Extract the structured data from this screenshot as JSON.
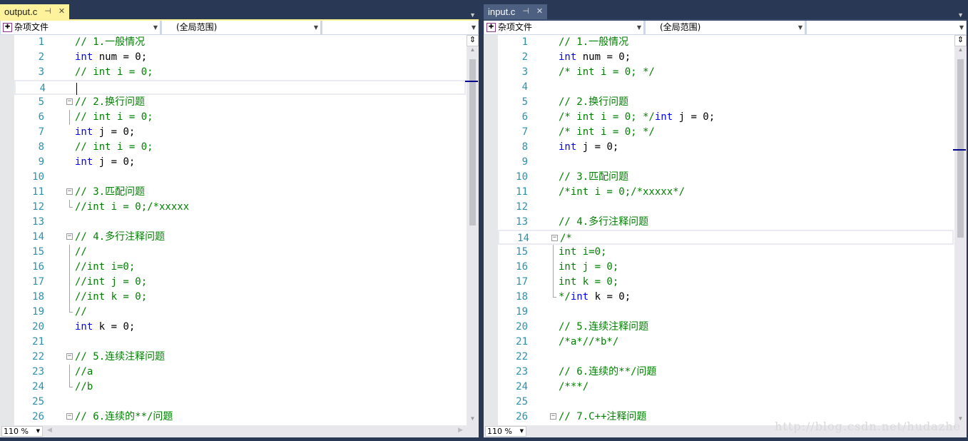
{
  "left": {
    "tab": {
      "title": "output.c",
      "pin": "⊣",
      "close": "✕",
      "active": true
    },
    "nav": {
      "project": "杂项文件",
      "scope": "(全局范围)",
      "member": ""
    },
    "zoom": "110 %",
    "current_line": 4,
    "lines": [
      {
        "n": 1,
        "s": [
          [
            "c",
            "// 1.一般情况"
          ]
        ]
      },
      {
        "n": 2,
        "s": [
          [
            "k",
            "int"
          ],
          [
            "t",
            " num = 0;"
          ]
        ]
      },
      {
        "n": 3,
        "s": [
          [
            "c",
            "// int i = 0;"
          ]
        ]
      },
      {
        "n": 4,
        "s": []
      },
      {
        "n": 5,
        "f": "start",
        "s": [
          [
            "c",
            "// 2.换行问题"
          ]
        ]
      },
      {
        "n": 6,
        "f": "mid",
        "s": [
          [
            "c",
            "// int i = 0;"
          ]
        ]
      },
      {
        "n": 7,
        "s": [
          [
            "k",
            "int"
          ],
          [
            "t",
            " j = 0;"
          ]
        ]
      },
      {
        "n": 8,
        "s": [
          [
            "c",
            "// int i = 0;"
          ]
        ]
      },
      {
        "n": 9,
        "s": [
          [
            "k",
            "int"
          ],
          [
            "t",
            " j = 0;"
          ]
        ]
      },
      {
        "n": 10,
        "s": []
      },
      {
        "n": 11,
        "f": "start",
        "s": [
          [
            "c",
            "// 3.匹配问题"
          ]
        ]
      },
      {
        "n": 12,
        "f": "end",
        "s": [
          [
            "c",
            "//int i = 0;/*xxxxx"
          ]
        ]
      },
      {
        "n": 13,
        "s": []
      },
      {
        "n": 14,
        "f": "start",
        "s": [
          [
            "c",
            "// 4.多行注释问题"
          ]
        ]
      },
      {
        "n": 15,
        "f": "mid",
        "s": [
          [
            "c",
            "//"
          ]
        ]
      },
      {
        "n": 16,
        "f": "mid",
        "s": [
          [
            "c",
            "//int i=0;"
          ]
        ]
      },
      {
        "n": 17,
        "f": "mid",
        "s": [
          [
            "c",
            "//int j = 0;"
          ]
        ]
      },
      {
        "n": 18,
        "f": "mid",
        "s": [
          [
            "c",
            "//int k = 0;"
          ]
        ]
      },
      {
        "n": 19,
        "f": "end",
        "s": [
          [
            "c",
            "//"
          ]
        ]
      },
      {
        "n": 20,
        "s": [
          [
            "k",
            "int"
          ],
          [
            "t",
            " k = 0;"
          ]
        ]
      },
      {
        "n": 21,
        "s": []
      },
      {
        "n": 22,
        "f": "start",
        "s": [
          [
            "c",
            "// 5.连续注释问题"
          ]
        ]
      },
      {
        "n": 23,
        "f": "mid",
        "s": [
          [
            "c",
            "//a"
          ]
        ]
      },
      {
        "n": 24,
        "f": "end",
        "s": [
          [
            "c",
            "//b"
          ]
        ]
      },
      {
        "n": 25,
        "s": []
      },
      {
        "n": 26,
        "f": "start",
        "s": [
          [
            "c",
            "// 6.连续的**/问题"
          ]
        ]
      }
    ]
  },
  "right": {
    "tab": {
      "title": "input.c",
      "pin": "⊣",
      "close": "✕",
      "active": false
    },
    "nav": {
      "project": "杂项文件",
      "scope": "(全局范围)",
      "member": ""
    },
    "zoom": "110 %",
    "current_line": 14,
    "lines": [
      {
        "n": 1,
        "s": [
          [
            "c",
            "// 1.一般情况"
          ]
        ]
      },
      {
        "n": 2,
        "s": [
          [
            "k",
            "int"
          ],
          [
            "t",
            " num = 0;"
          ]
        ]
      },
      {
        "n": 3,
        "s": [
          [
            "c",
            "/* int i = 0; */"
          ]
        ]
      },
      {
        "n": 4,
        "s": []
      },
      {
        "n": 5,
        "s": [
          [
            "c",
            "// 2.换行问题"
          ]
        ]
      },
      {
        "n": 6,
        "s": [
          [
            "c",
            "/* int i = 0; */"
          ],
          [
            "k",
            "int"
          ],
          [
            "t",
            " j = 0;"
          ]
        ]
      },
      {
        "n": 7,
        "s": [
          [
            "c",
            "/* int i = 0; */"
          ]
        ]
      },
      {
        "n": 8,
        "s": [
          [
            "k",
            "int"
          ],
          [
            "t",
            " j = 0;"
          ]
        ]
      },
      {
        "n": 9,
        "s": []
      },
      {
        "n": 10,
        "s": [
          [
            "c",
            "// 3.匹配问题"
          ]
        ]
      },
      {
        "n": 11,
        "s": [
          [
            "c",
            "/*int i = 0;/*xxxxx*/"
          ]
        ]
      },
      {
        "n": 12,
        "s": []
      },
      {
        "n": 13,
        "s": [
          [
            "c",
            "// 4.多行注释问题"
          ]
        ]
      },
      {
        "n": 14,
        "f": "start",
        "s": [
          [
            "c",
            "/*"
          ]
        ]
      },
      {
        "n": 15,
        "f": "mid",
        "s": [
          [
            "c",
            "int i=0;"
          ]
        ]
      },
      {
        "n": 16,
        "f": "mid",
        "s": [
          [
            "c",
            "int j = 0;"
          ]
        ]
      },
      {
        "n": 17,
        "f": "mid",
        "s": [
          [
            "c",
            "int k = 0;"
          ]
        ]
      },
      {
        "n": 18,
        "f": "end",
        "s": [
          [
            "c",
            "*/"
          ],
          [
            "k",
            "int"
          ],
          [
            "t",
            " k = 0;"
          ]
        ]
      },
      {
        "n": 19,
        "s": []
      },
      {
        "n": 20,
        "s": [
          [
            "c",
            "// 5.连续注释问题"
          ]
        ]
      },
      {
        "n": 21,
        "s": [
          [
            "c",
            "/*a*//*b*/"
          ]
        ]
      },
      {
        "n": 22,
        "s": []
      },
      {
        "n": 23,
        "s": [
          [
            "c",
            "// 6.连续的**/问题"
          ]
        ]
      },
      {
        "n": 24,
        "s": [
          [
            "c",
            "/***/"
          ]
        ]
      },
      {
        "n": 25,
        "s": []
      },
      {
        "n": 26,
        "f": "start",
        "s": [
          [
            "c",
            "// 7.C++注释问题"
          ]
        ]
      }
    ]
  },
  "watermark": "http://blog.csdn.net/hudazhe"
}
